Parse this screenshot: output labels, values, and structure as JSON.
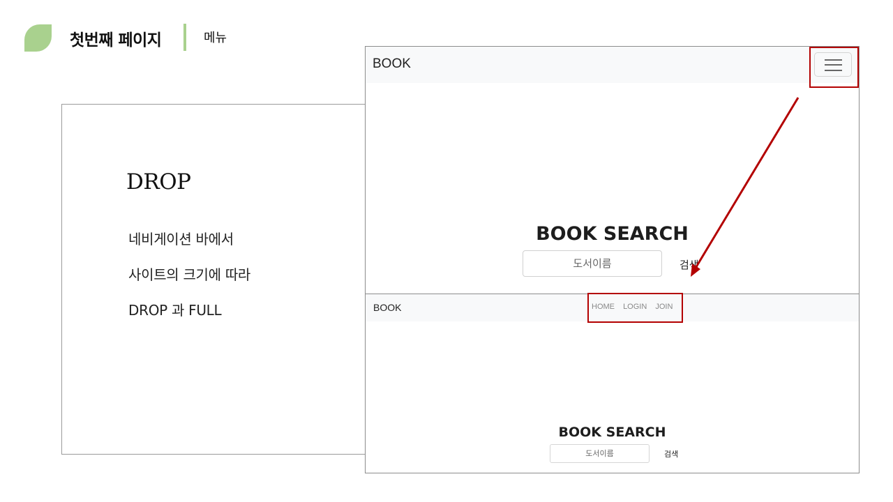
{
  "header": {
    "title": "첫번째 페이지",
    "section": "메뉴"
  },
  "description": {
    "heading": "DROP",
    "lines": [
      "네비게이션 바에서",
      "사이트의 크기에 따라",
      "DROP 과 FULL"
    ]
  },
  "screenshot_drop": {
    "brand": "BOOK",
    "toggler_icon": "hamburger-menu-icon",
    "search_title": "BOOK SEARCH",
    "search_placeholder": "도서이름",
    "search_button": "검색"
  },
  "screenshot_full": {
    "brand": "BOOK",
    "nav_links": [
      "HOME",
      "LOGIN",
      "JOIN"
    ],
    "search_title": "BOOK SEARCH",
    "search_placeholder": "도서이름",
    "search_button": "검색"
  },
  "colors": {
    "accent_green": "#a9d18e",
    "highlight_red": "#b30000",
    "navbar_bg": "#f8f9fa"
  }
}
